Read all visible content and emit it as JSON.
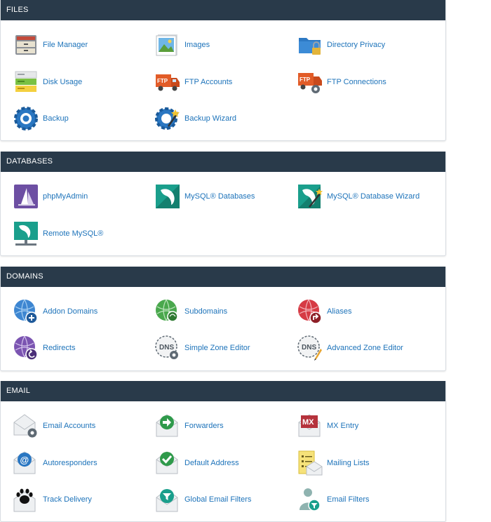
{
  "sections": {
    "files": {
      "title": "FILES",
      "items": [
        {
          "label": "File Manager",
          "icon": "file-manager-icon"
        },
        {
          "label": "Images",
          "icon": "images-icon"
        },
        {
          "label": "Directory Privacy",
          "icon": "directory-privacy-icon"
        },
        {
          "label": "Disk Usage",
          "icon": "disk-usage-icon"
        },
        {
          "label": "FTP Accounts",
          "icon": "ftp-accounts-icon"
        },
        {
          "label": "FTP Connections",
          "icon": "ftp-connections-icon"
        },
        {
          "label": "Backup",
          "icon": "backup-icon"
        },
        {
          "label": "Backup Wizard",
          "icon": "backup-wizard-icon"
        }
      ]
    },
    "databases": {
      "title": "DATABASES",
      "items": [
        {
          "label": "phpMyAdmin",
          "icon": "phpmyadmin-icon"
        },
        {
          "label": "MySQL® Databases",
          "icon": "mysql-databases-icon"
        },
        {
          "label": "MySQL® Database Wizard",
          "icon": "mysql-database-wizard-icon"
        },
        {
          "label": "Remote MySQL®",
          "icon": "remote-mysql-icon"
        }
      ]
    },
    "domains": {
      "title": "DOMAINS",
      "items": [
        {
          "label": "Addon Domains",
          "icon": "addon-domains-icon"
        },
        {
          "label": "Subdomains",
          "icon": "subdomains-icon"
        },
        {
          "label": "Aliases",
          "icon": "aliases-icon"
        },
        {
          "label": "Redirects",
          "icon": "redirects-icon"
        },
        {
          "label": "Simple Zone Editor",
          "icon": "simple-zone-editor-icon"
        },
        {
          "label": "Advanced Zone Editor",
          "icon": "advanced-zone-editor-icon"
        }
      ]
    },
    "email": {
      "title": "EMAIL",
      "items": [
        {
          "label": "Email Accounts",
          "icon": "email-accounts-icon"
        },
        {
          "label": "Forwarders",
          "icon": "forwarders-icon"
        },
        {
          "label": "MX Entry",
          "icon": "mx-entry-icon"
        },
        {
          "label": "Autoresponders",
          "icon": "autoresponders-icon"
        },
        {
          "label": "Default Address",
          "icon": "default-address-icon"
        },
        {
          "label": "Mailing Lists",
          "icon": "mailing-lists-icon"
        },
        {
          "label": "Track Delivery",
          "icon": "track-delivery-icon"
        },
        {
          "label": "Global Email Filters",
          "icon": "global-email-filters-icon"
        },
        {
          "label": "Email Filters",
          "icon": "email-filters-icon"
        }
      ]
    }
  },
  "icon_text": {
    "ftp": "FTP",
    "dns": "DNS",
    "mx": "MX",
    "at": "@"
  },
  "colors": {
    "header_bg": "#293a4a",
    "link": "#1d73ba",
    "icon_blue": "#2a77c2",
    "icon_purple": "#6d4fa3",
    "icon_teal": "#1a9f8c",
    "icon_green": "#4aa84d",
    "icon_red": "#d63b45",
    "icon_orange": "#e25c28"
  }
}
